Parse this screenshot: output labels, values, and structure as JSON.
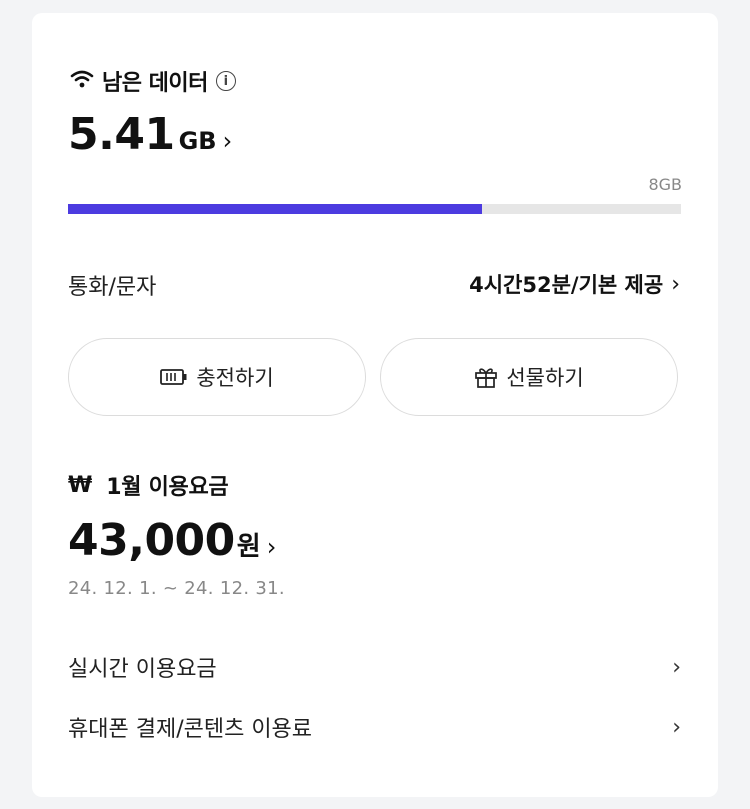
{
  "data_usage": {
    "title": "남은 데이터",
    "remaining_value": "5.41",
    "remaining_unit": "GB",
    "total_label": "8GB",
    "usage_fraction": 0.676
  },
  "call_text": {
    "label": "통화/문자",
    "value": "4시간52분/기본 제공"
  },
  "actions": {
    "charge_label": "충전하기",
    "gift_label": "선물하기"
  },
  "billing": {
    "currency_symbol": "₩",
    "title": "1월 이용요금",
    "amount": "43,000",
    "amount_unit": "원",
    "period": "24. 12. 1. ~ 24. 12. 31."
  },
  "links": [
    {
      "label": "실시간 이용요금"
    },
    {
      "label": "휴대폰 결제/콘텐츠 이용료"
    }
  ],
  "colors": {
    "accent": "#4c3be0",
    "track": "#e6e6e6",
    "background": "#f3f4f6"
  }
}
